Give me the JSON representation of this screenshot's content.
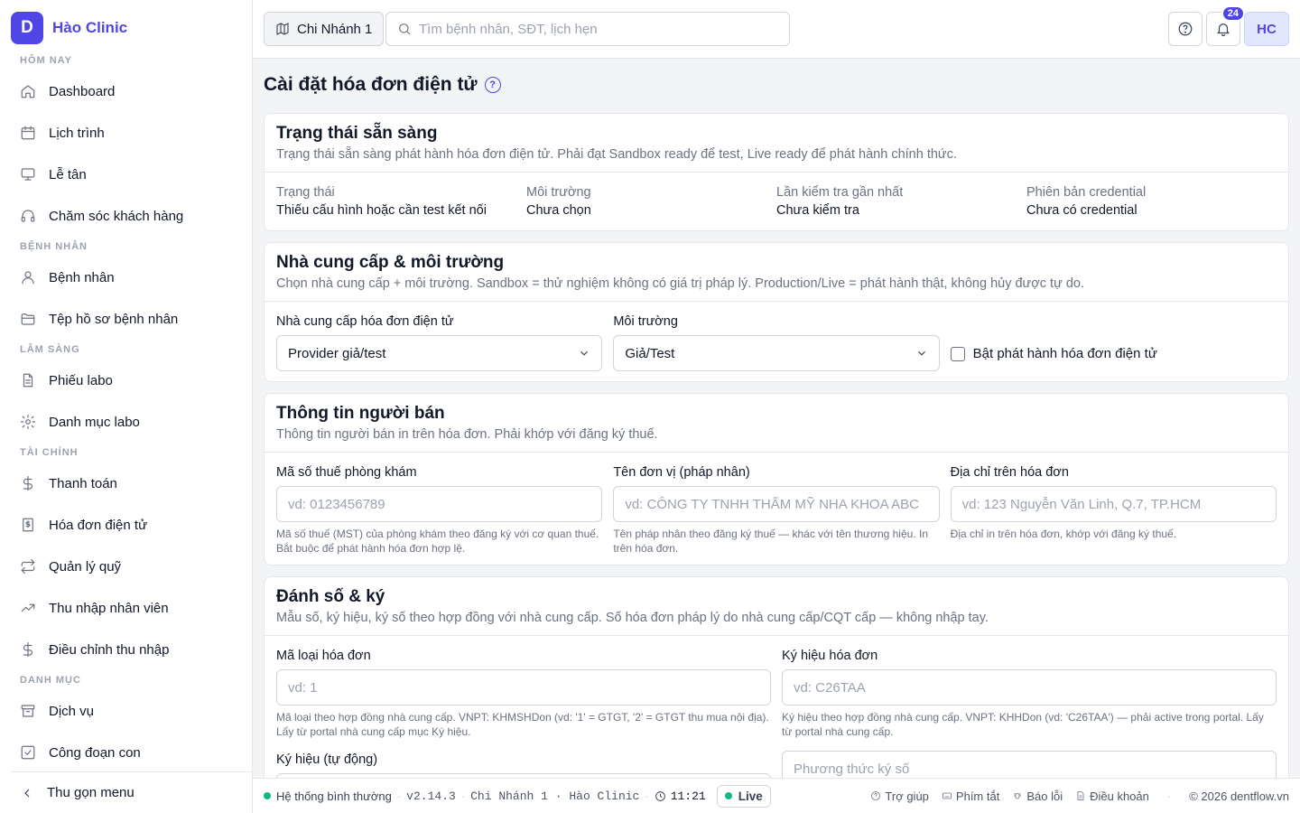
{
  "brand": {
    "logo_letter": "D",
    "name": "Hào Clinic",
    "color": "#4f46e5"
  },
  "sidebar": {
    "sections": [
      {
        "title": "HÔM NAY",
        "items": [
          {
            "label": "Dashboard",
            "icon": "home-icon"
          },
          {
            "label": "Lịch trình",
            "icon": "calendar-icon"
          },
          {
            "label": "Lễ tân",
            "icon": "monitor-icon"
          },
          {
            "label": "Chăm sóc khách hàng",
            "icon": "headphones-icon"
          }
        ]
      },
      {
        "title": "BỆNH NHÂN",
        "items": [
          {
            "label": "Bệnh nhân",
            "icon": "user-icon"
          },
          {
            "label": "Tệp hồ sơ bệnh nhân",
            "icon": "folder-icon"
          }
        ]
      },
      {
        "title": "LÂM SÀNG",
        "items": [
          {
            "label": "Phiếu labo",
            "icon": "file-icon"
          },
          {
            "label": "Danh mục labo",
            "icon": "gear-icon"
          }
        ]
      },
      {
        "title": "TÀI CHÍNH",
        "items": [
          {
            "label": "Thanh toán",
            "icon": "dollar-icon"
          },
          {
            "label": "Hóa đơn điện tử",
            "icon": "invoice-icon"
          },
          {
            "label": "Quản lý quỹ",
            "icon": "repeat-icon"
          },
          {
            "label": "Thu nhập nhân viên",
            "icon": "trending-up-icon"
          },
          {
            "label": "Điều chỉnh thu nhập",
            "icon": "dollar-icon"
          }
        ]
      },
      {
        "title": "DANH MỤC",
        "items": [
          {
            "label": "Dịch vụ",
            "icon": "archive-icon"
          },
          {
            "label": "Công đoạn con",
            "icon": "checkbox-icon"
          }
        ]
      }
    ],
    "collapse_label": "Thu gọn menu"
  },
  "topbar": {
    "branch_label": "Chi Nhánh 1",
    "search_placeholder": "Tìm bệnh nhân, SĐT, lịch hẹn",
    "notification_count": "24",
    "avatar_initials": "HC"
  },
  "page": {
    "title": "Cài đặt hóa đơn điện tử",
    "help_glyph": "?"
  },
  "readiness": {
    "title": "Trạng thái sẵn sàng",
    "desc": "Trạng thái sẵn sàng phát hành hóa đơn điện tử. Phải đạt Sandbox ready để test, Live ready để phát hành chính thức.",
    "items": [
      {
        "label": "Trạng thái",
        "value": "Thiếu cấu hình hoặc cần test kết nối"
      },
      {
        "label": "Môi trường",
        "value": "Chưa chọn"
      },
      {
        "label": "Lần kiểm tra gần nhất",
        "value": "Chưa kiểm tra"
      },
      {
        "label": "Phiên bản credential",
        "value": "Chưa có credential"
      }
    ]
  },
  "provider": {
    "title": "Nhà cung cấp & môi trường",
    "desc": "Chọn nhà cung cấp + môi trường. Sandbox = thử nghiệm không có giá trị pháp lý. Production/Live = phát hành thật, không hủy được tự do.",
    "provider_label": "Nhà cung cấp hóa đơn điện tử",
    "provider_value": "Provider giả/test",
    "env_label": "Môi trường",
    "env_value": "Giả/Test",
    "enable_label": "Bật phát hành hóa đơn điện tử"
  },
  "seller": {
    "title": "Thông tin người bán",
    "desc": "Thông tin người bán in trên hóa đơn. Phải khớp với đăng ký thuế.",
    "tax_label": "Mã số thuế phòng khám",
    "tax_placeholder": "vd: 0123456789",
    "tax_hint": "Mã số thuế (MST) của phòng khám theo đăng ký với cơ quan thuế. Bắt buộc để phát hành hóa đơn hợp lệ.",
    "name_label": "Tên đơn vị (pháp nhân)",
    "name_placeholder": "vd: CÔNG TY TNHH THẨM MỸ NHA KHOA ABC",
    "name_hint": "Tên pháp nhân theo đăng ký thuế — khác với tên thương hiệu. In trên hóa đơn.",
    "addr_label": "Địa chỉ trên hóa đơn",
    "addr_placeholder": "vd: 123 Nguyễn Văn Linh, Q.7, TP.HCM",
    "addr_hint": "Địa chỉ in trên hóa đơn, khớp với đăng ký thuế."
  },
  "numbering": {
    "title": "Đánh số & ký",
    "desc": "Mẫu số, ký hiệu, ký số theo hợp đồng với nhà cung cấp. Số hóa đơn pháp lý do nhà cung cấp/CQT cấp — không nhập tay.",
    "type_label": "Mã loại hóa đơn",
    "type_placeholder": "vd: 1",
    "type_hint": "Mã loại theo hợp đồng nhà cung cấp. VNPT: KHMSHDon (vd: '1' = GTGT, '2' = GTGT thu mua nội địa). Lấy từ portal nhà cung cấp mục Ký hiệu.",
    "symbol_label": "Ký hiệu hóa đơn",
    "symbol_placeholder": "vd: C26TAA",
    "symbol_hint": "Ký hiệu theo hợp đồng nhà cung cấp. VNPT: KHHDon (vd: 'C26TAA') — phải active trong portal. Lấy từ portal nhà cung cấp.",
    "auto_label": "Ký hiệu (tự động)",
    "sign_placeholder": "Phương thức ký số"
  },
  "footer": {
    "system_status": "Hệ thống bình thường",
    "version": "v2.14.3",
    "location": "Chi Nhánh 1 · Hào Clinic",
    "time": "11:21",
    "live_label": "Live",
    "help": "Trợ giúp",
    "shortcuts": "Phím tắt",
    "report": "Báo lỗi",
    "terms": "Điều khoản",
    "copyright": "© 2026 dentflow.vn"
  }
}
